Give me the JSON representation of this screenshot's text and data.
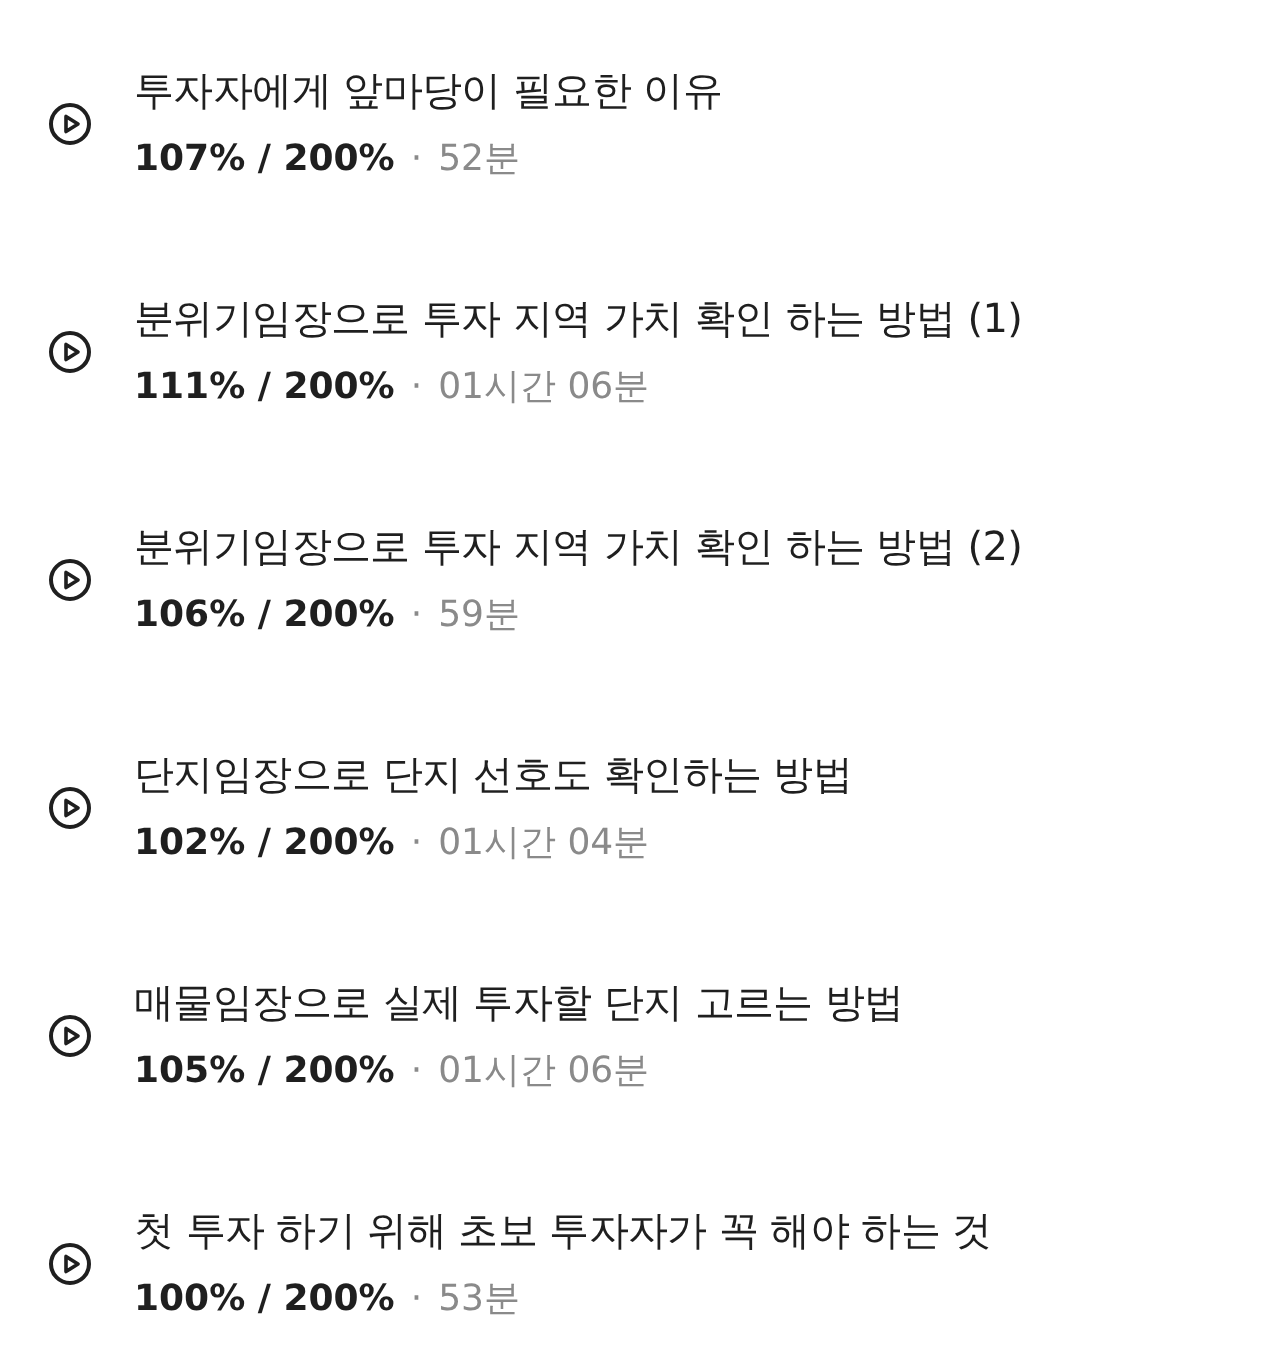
{
  "lessons": [
    {
      "title": "투자자에게 앞마당이 필요한 이유",
      "progress": "107% / 200%",
      "separator": "·",
      "duration": "52분"
    },
    {
      "title": "분위기임장으로 투자 지역 가치 확인 하는 방법 (1)",
      "progress": "111% / 200%",
      "separator": "·",
      "duration": "01시간 06분"
    },
    {
      "title": "분위기임장으로 투자 지역 가치 확인 하는 방법 (2)",
      "progress": "106% / 200%",
      "separator": "·",
      "duration": "59분"
    },
    {
      "title": "단지임장으로 단지 선호도 확인하는 방법",
      "progress": "102% / 200%",
      "separator": "·",
      "duration": "01시간 04분"
    },
    {
      "title": "매물임장으로 실제 투자할 단지 고르는 방법",
      "progress": "105% / 200%",
      "separator": "·",
      "duration": "01시간 06분"
    },
    {
      "title": "첫 투자 하기 위해 초보 투자자가 꼭 해야 하는 것",
      "progress": "100% / 200%",
      "separator": "·",
      "duration": "53분"
    }
  ]
}
